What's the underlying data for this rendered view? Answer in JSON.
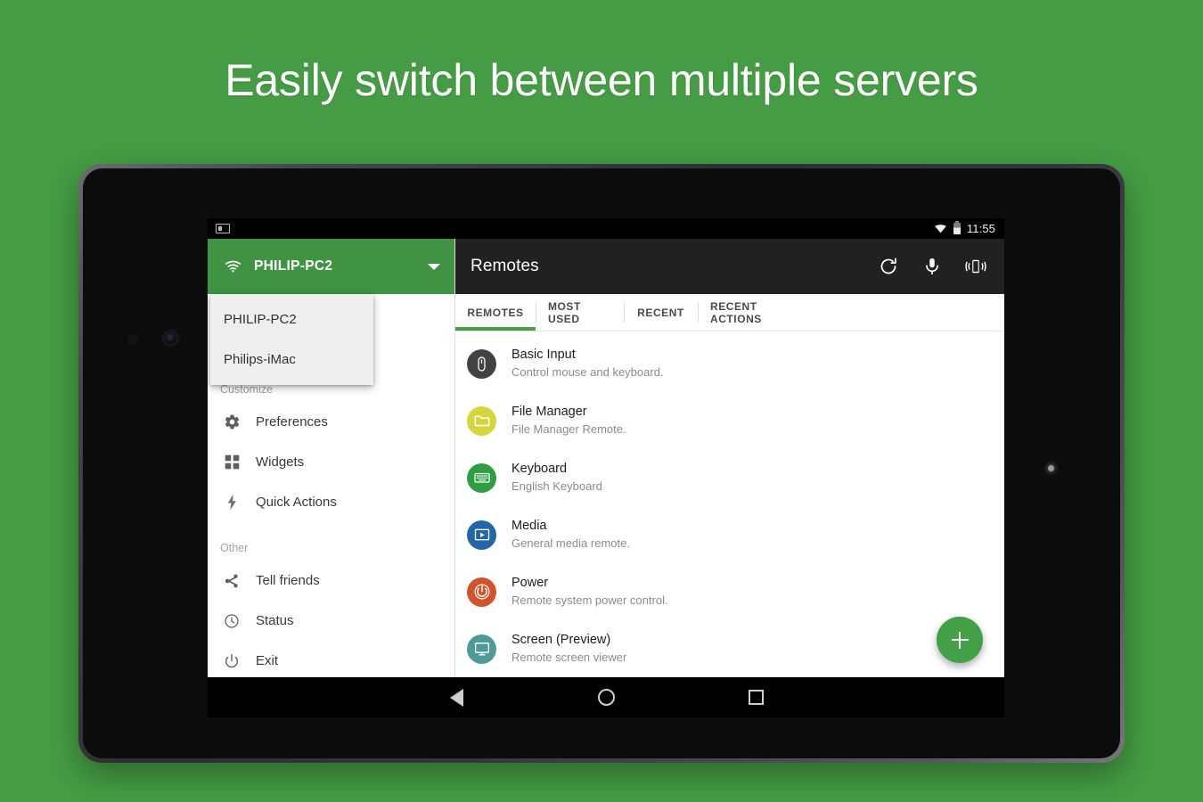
{
  "headline": "Easily switch between multiple servers",
  "colors": {
    "background_green": "#459c44",
    "header_green": "#3f9342",
    "appbar_dark": "#212121",
    "accent_green": "#43a047"
  },
  "status_bar": {
    "multiwindow_icon": "multiwindow-icon",
    "wifi_icon": "wifi-icon",
    "battery_icon": "battery-icon",
    "clock": "11:55"
  },
  "sidebar": {
    "server": {
      "wifi_icon": "wifi-icon",
      "name": "PHILIP-PC2",
      "caret_icon": "chevron-down-icon"
    },
    "dropdown": {
      "items": [
        {
          "label": "PHILIP-PC2"
        },
        {
          "label": "Philips-iMac"
        }
      ]
    },
    "sections": [
      {
        "label": "Customize",
        "items": [
          {
            "label": "Preferences",
            "icon": "gear-icon"
          },
          {
            "label": "Widgets",
            "icon": "grid-icon"
          },
          {
            "label": "Quick Actions",
            "icon": "bolt-icon"
          }
        ]
      },
      {
        "label": "Other",
        "items": [
          {
            "label": "Tell friends",
            "icon": "share-icon"
          },
          {
            "label": "Status",
            "icon": "clock-icon"
          },
          {
            "label": "Exit",
            "icon": "power-icon"
          }
        ]
      }
    ]
  },
  "appbar": {
    "title": "Remotes",
    "actions": [
      {
        "name": "refresh-icon"
      },
      {
        "name": "microphone-icon"
      },
      {
        "name": "vibrate-icon"
      }
    ]
  },
  "tabs": [
    {
      "label": "REMOTES",
      "active": true
    },
    {
      "label": "MOST USED",
      "active": false
    },
    {
      "label": "RECENT",
      "active": false
    },
    {
      "label": "RECENT ACTIONS",
      "active": false
    }
  ],
  "remotes": [
    {
      "title": "Basic Input",
      "subtitle": "Control mouse and keyboard.",
      "icon": "mouse-icon",
      "color": "#424242"
    },
    {
      "title": "File Manager",
      "subtitle": "File Manager Remote.",
      "icon": "folder-icon",
      "color": "#d4d63c"
    },
    {
      "title": "Keyboard",
      "subtitle": "English Keyboard",
      "icon": "keyboard-icon",
      "color": "#2f9e43"
    },
    {
      "title": "Media",
      "subtitle": "General media remote.",
      "icon": "media-icon",
      "color": "#2265ab"
    },
    {
      "title": "Power",
      "subtitle": "Remote system power control.",
      "icon": "power-icon",
      "color": "#d1532c"
    },
    {
      "title": "Screen (Preview)",
      "subtitle": "Remote screen viewer",
      "icon": "monitor-icon",
      "color": "#4e9a99"
    }
  ],
  "fab": {
    "label": "+",
    "icon": "plus-icon"
  },
  "navbar": {
    "back": "back-icon",
    "home": "home-icon",
    "recents": "recents-icon"
  }
}
